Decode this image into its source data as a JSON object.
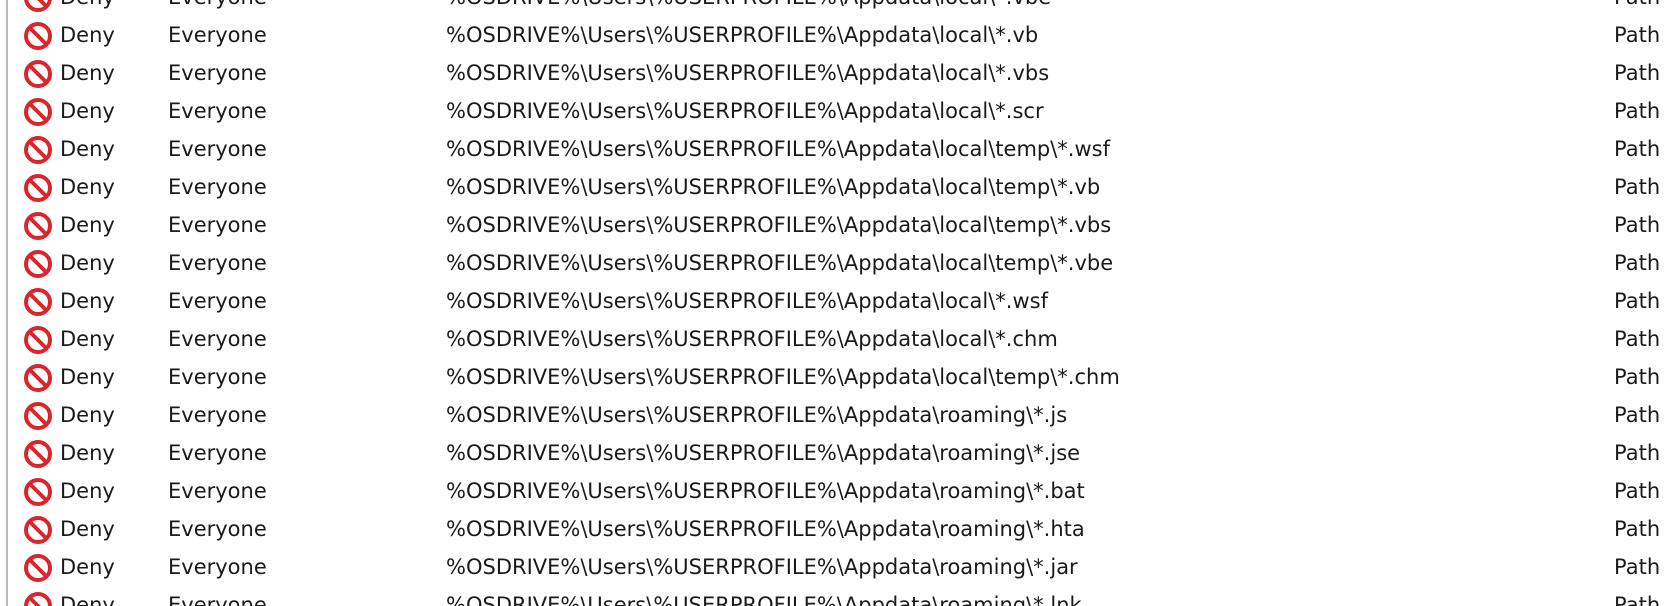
{
  "rules": [
    {
      "action": "Deny",
      "user": "Everyone",
      "condition": "%OSDRIVE%\\Users\\%USERPROFILE%\\Appdata\\local\\*.vbe",
      "type": "Path",
      "icon": "deny-icon"
    },
    {
      "action": "Deny",
      "user": "Everyone",
      "condition": "%OSDRIVE%\\Users\\%USERPROFILE%\\Appdata\\local\\*.vb",
      "type": "Path",
      "icon": "deny-icon"
    },
    {
      "action": "Deny",
      "user": "Everyone",
      "condition": "%OSDRIVE%\\Users\\%USERPROFILE%\\Appdata\\local\\*.vbs",
      "type": "Path",
      "icon": "deny-icon"
    },
    {
      "action": "Deny",
      "user": "Everyone",
      "condition": "%OSDRIVE%\\Users\\%USERPROFILE%\\Appdata\\local\\*.scr",
      "type": "Path",
      "icon": "deny-icon"
    },
    {
      "action": "Deny",
      "user": "Everyone",
      "condition": "%OSDRIVE%\\Users\\%USERPROFILE%\\Appdata\\local\\temp\\*.wsf",
      "type": "Path",
      "icon": "deny-icon"
    },
    {
      "action": "Deny",
      "user": "Everyone",
      "condition": "%OSDRIVE%\\Users\\%USERPROFILE%\\Appdata\\local\\temp\\*.vb",
      "type": "Path",
      "icon": "deny-icon"
    },
    {
      "action": "Deny",
      "user": "Everyone",
      "condition": "%OSDRIVE%\\Users\\%USERPROFILE%\\Appdata\\local\\temp\\*.vbs",
      "type": "Path",
      "icon": "deny-icon"
    },
    {
      "action": "Deny",
      "user": "Everyone",
      "condition": "%OSDRIVE%\\Users\\%USERPROFILE%\\Appdata\\local\\temp\\*.vbe",
      "type": "Path",
      "icon": "deny-icon"
    },
    {
      "action": "Deny",
      "user": "Everyone",
      "condition": "%OSDRIVE%\\Users\\%USERPROFILE%\\Appdata\\local\\*.wsf",
      "type": "Path",
      "icon": "deny-icon"
    },
    {
      "action": "Deny",
      "user": "Everyone",
      "condition": "%OSDRIVE%\\Users\\%USERPROFILE%\\Appdata\\local\\*.chm",
      "type": "Path",
      "icon": "deny-icon"
    },
    {
      "action": "Deny",
      "user": "Everyone",
      "condition": "%OSDRIVE%\\Users\\%USERPROFILE%\\Appdata\\local\\temp\\*.chm",
      "type": "Path",
      "icon": "deny-icon"
    },
    {
      "action": "Deny",
      "user": "Everyone",
      "condition": "%OSDRIVE%\\Users\\%USERPROFILE%\\Appdata\\roaming\\*.js",
      "type": "Path",
      "icon": "deny-icon"
    },
    {
      "action": "Deny",
      "user": "Everyone",
      "condition": "%OSDRIVE%\\Users\\%USERPROFILE%\\Appdata\\roaming\\*.jse",
      "type": "Path",
      "icon": "deny-icon"
    },
    {
      "action": "Deny",
      "user": "Everyone",
      "condition": "%OSDRIVE%\\Users\\%USERPROFILE%\\Appdata\\roaming\\*.bat",
      "type": "Path",
      "icon": "deny-icon"
    },
    {
      "action": "Deny",
      "user": "Everyone",
      "condition": "%OSDRIVE%\\Users\\%USERPROFILE%\\Appdata\\roaming\\*.hta",
      "type": "Path",
      "icon": "deny-icon"
    },
    {
      "action": "Deny",
      "user": "Everyone",
      "condition": "%OSDRIVE%\\Users\\%USERPROFILE%\\Appdata\\roaming\\*.jar",
      "type": "Path",
      "icon": "deny-icon"
    },
    {
      "action": "Deny",
      "user": "Everyone",
      "condition": "%OSDRIVE%\\Users\\%USERPROFILE%\\Appdata\\roaming\\*.lnk",
      "type": "Path",
      "icon": "deny-icon"
    }
  ],
  "colors": {
    "deny_icon": "#d9262c",
    "text": "#1a1a1a",
    "border": "#b9b9b9"
  }
}
